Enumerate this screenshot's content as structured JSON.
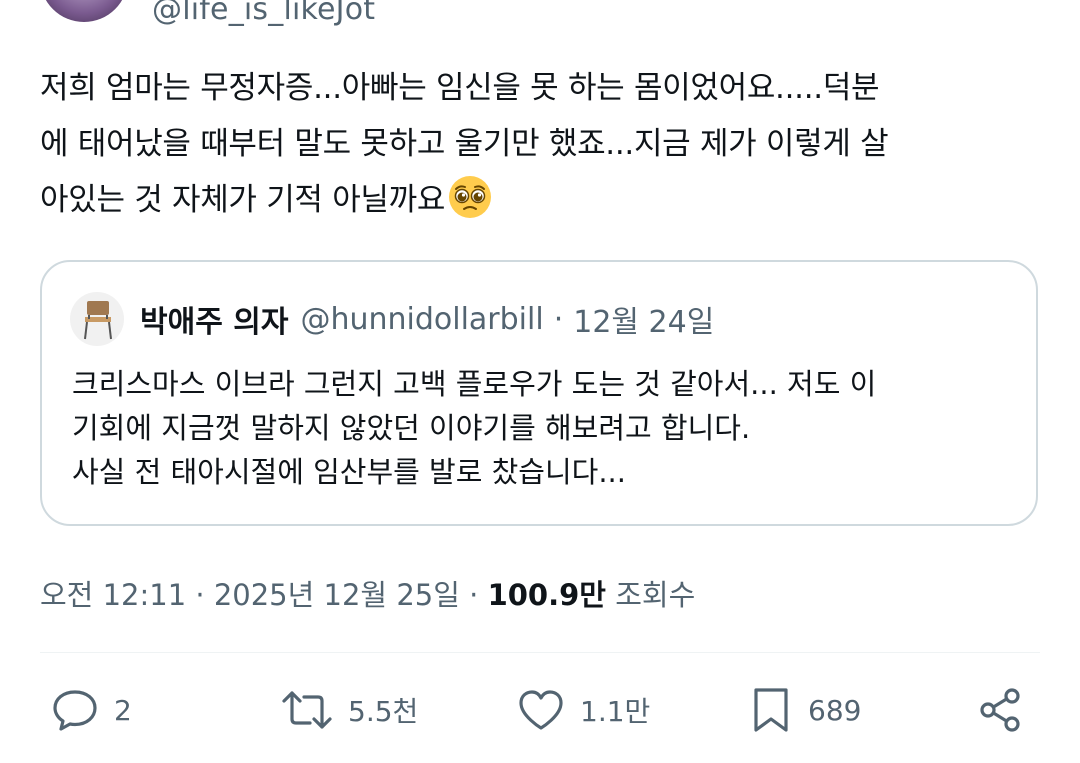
{
  "author": {
    "handle": "@life_is_likeJot"
  },
  "tweet": {
    "lines": [
      "저희 엄마는 무정자증...아빠는 임신을 못 하는 몸이었어요.....덕분",
      "에 태어났을 때부터 말도 못하고 울기만 했죠...지금 제가 이렇게 살",
      "아있는 것 자체가 기적 아닐까요"
    ],
    "emoji": "pleading-face"
  },
  "quote": {
    "name": "박애주 의자",
    "handle": "@hunnidollarbill",
    "dot": "·",
    "date": "12월 24일",
    "lines": [
      "크리스마스 이브라 그런지 고백 플로우가 도는 것 같아서... 저도 이",
      "기회에 지금껏 말하지 않았던 이야기를 해보려고 합니다.",
      "사실 전 태아시절에 임산부를 발로 찼습니다..."
    ]
  },
  "meta": {
    "time": "오전 12:11",
    "sep1": " · ",
    "date": "2025년 12월 25일",
    "sep2": " · ",
    "views_count": "100.9만",
    "views_label": " 조회수"
  },
  "actions": {
    "replies": "2",
    "retweets": "5.5천",
    "likes": "1.1만",
    "bookmarks": "689"
  },
  "colors": {
    "text": "#0f1419",
    "secondary": "#536471",
    "border": "#cfd9de"
  }
}
